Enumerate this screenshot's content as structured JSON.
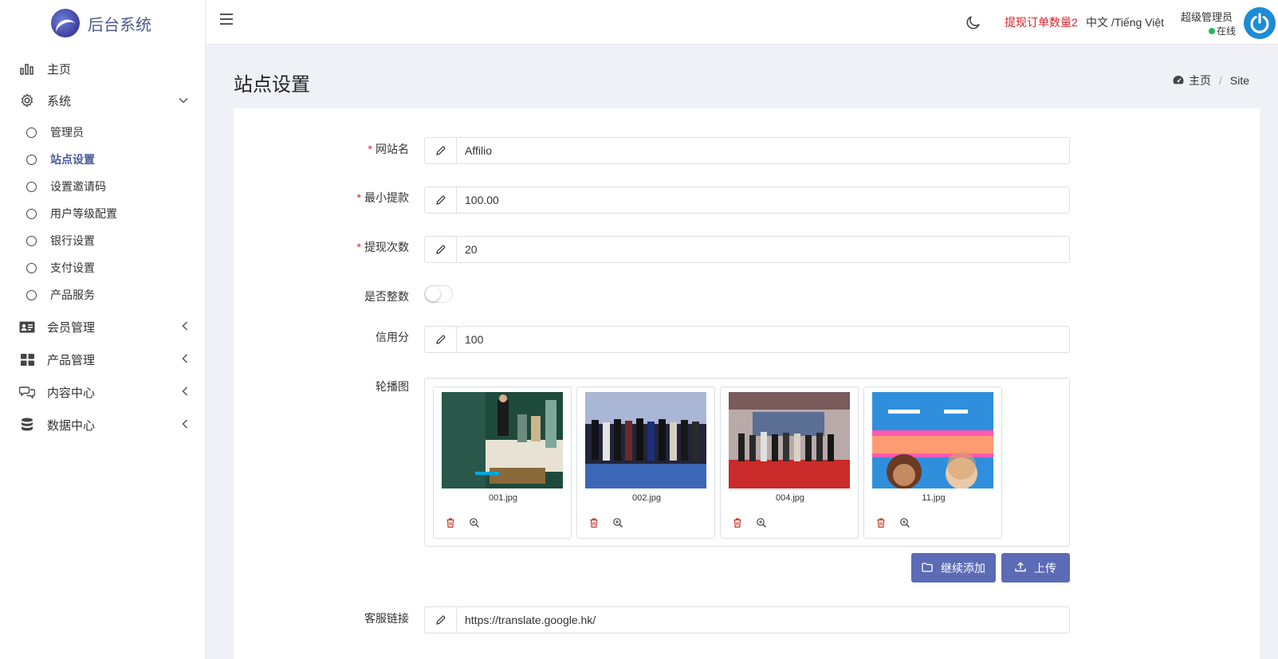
{
  "app": {
    "title": "后台系统"
  },
  "sidebar": {
    "items": [
      {
        "label": "主页"
      },
      {
        "label": "系统",
        "expanded": true,
        "children": [
          "管理员",
          "站点设置",
          "设置邀请码",
          "用户等级配置",
          "银行设置",
          "支付设置",
          "产品服务"
        ],
        "active_child": "站点设置"
      },
      {
        "label": "会员管理"
      },
      {
        "label": "产品管理"
      },
      {
        "label": "内容中心"
      },
      {
        "label": "数据中心"
      }
    ]
  },
  "topbar": {
    "alert": "提现订单数量2",
    "language": "中文 /Tiếng Việt",
    "user": {
      "name": "超级管理员",
      "status": "在线"
    }
  },
  "page": {
    "title": "站点设置",
    "breadcrumb": [
      "主页",
      "Site"
    ]
  },
  "form": {
    "site_name": {
      "label": "网站名",
      "required": true,
      "value": "Affilio"
    },
    "min_withdraw": {
      "label": "最小提款",
      "required": true,
      "value": "100.00"
    },
    "withdraw_times": {
      "label": "提现次数",
      "required": true,
      "value": "20"
    },
    "integer": {
      "label": "是否整数",
      "on": false
    },
    "credit": {
      "label": "信用分",
      "value": "100"
    },
    "carousel": {
      "label": "轮播图",
      "images": [
        {
          "file": "001.jpg"
        },
        {
          "file": "002.jpg"
        },
        {
          "file": "004.jpg"
        },
        {
          "file": "11.jpg"
        }
      ]
    },
    "buttons": {
      "add_more": "继续添加",
      "upload": "上传"
    },
    "service_link": {
      "label": "客服链接",
      "value": "https://translate.google.hk/"
    }
  },
  "colors": {
    "accent": "#5b6bb5",
    "alert": "#d9232b",
    "online": "#27b35d"
  }
}
